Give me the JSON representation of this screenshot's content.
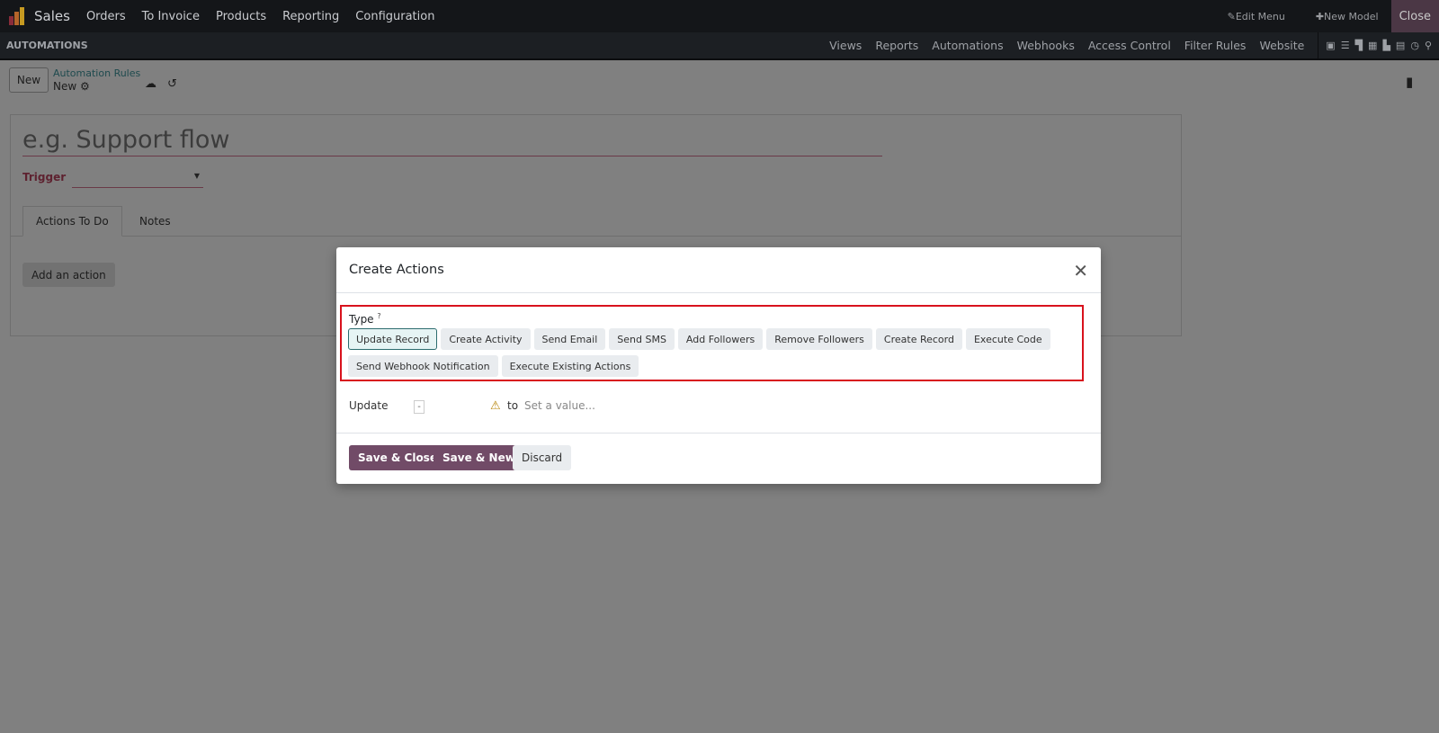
{
  "topbar": {
    "app": "Sales",
    "menus": [
      "Orders",
      "To Invoice",
      "Products",
      "Reporting",
      "Configuration"
    ],
    "edit_menu": "Edit Menu",
    "new_model": "New Model",
    "close": "Close"
  },
  "subbar": {
    "title": "AUTOMATIONS",
    "links": [
      "Views",
      "Reports",
      "Automations",
      "Webhooks",
      "Access Control",
      "Filter Rules",
      "Website"
    ]
  },
  "control": {
    "new_button": "New",
    "breadcrumb_parent": "Automation Rules",
    "breadcrumb_current": "New"
  },
  "form": {
    "name_placeholder": "e.g. Support flow",
    "trigger_label": "Trigger",
    "tabs": [
      "Actions To Do",
      "Notes"
    ],
    "add_action": "Add an action"
  },
  "modal": {
    "title": "Create Actions",
    "type_label": "Type",
    "help": "?",
    "types": [
      "Update Record",
      "Create Activity",
      "Send Email",
      "Send SMS",
      "Add Followers",
      "Remove Followers",
      "Create Record",
      "Execute Code",
      "Send Webhook Notification",
      "Execute Existing Actions"
    ],
    "selected_type": "Update Record",
    "update_label": "Update",
    "field_value": "-",
    "to_label": "to",
    "value_placeholder": "Set a value...",
    "save_close": "Save & Close",
    "save_new": "Save & New",
    "discard": "Discard"
  }
}
